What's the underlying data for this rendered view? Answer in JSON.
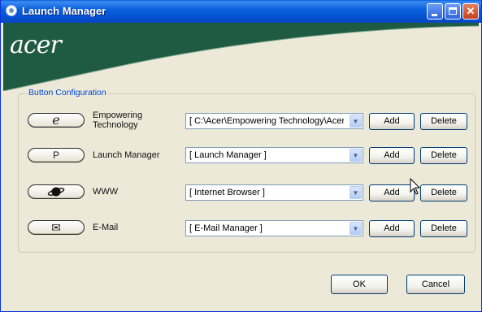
{
  "window": {
    "title": "Launch Manager",
    "logo": "acer"
  },
  "group": {
    "label": "Button Configuration"
  },
  "rows": [
    {
      "label_line1": "Empowering",
      "label_line2": "Technology",
      "button_glyph": "e",
      "combo_value": "[ C:\\Acer\\Empowering Technology\\Acer",
      "add": "Add",
      "delete": "Delete"
    },
    {
      "label_line1": "Launch Manager",
      "label_line2": "",
      "button_glyph": "P",
      "combo_value": "[ Launch Manager ]",
      "add": "Add",
      "delete": "Delete"
    },
    {
      "label_line1": "WWW",
      "label_line2": "",
      "button_glyph": "",
      "combo_value": "[ Internet Browser ]",
      "add": "Add",
      "delete": "Delete"
    },
    {
      "label_line1": "E-Mail",
      "label_line2": "",
      "button_glyph": "✉",
      "combo_value": "[ E-Mail Manager ]",
      "add": "Add",
      "delete": "Delete"
    }
  ],
  "footer": {
    "ok": "OK",
    "cancel": "Cancel"
  },
  "colors": {
    "banner": "#1f5a42",
    "title_bar": "#0554d3",
    "legend": "#0046d5"
  }
}
